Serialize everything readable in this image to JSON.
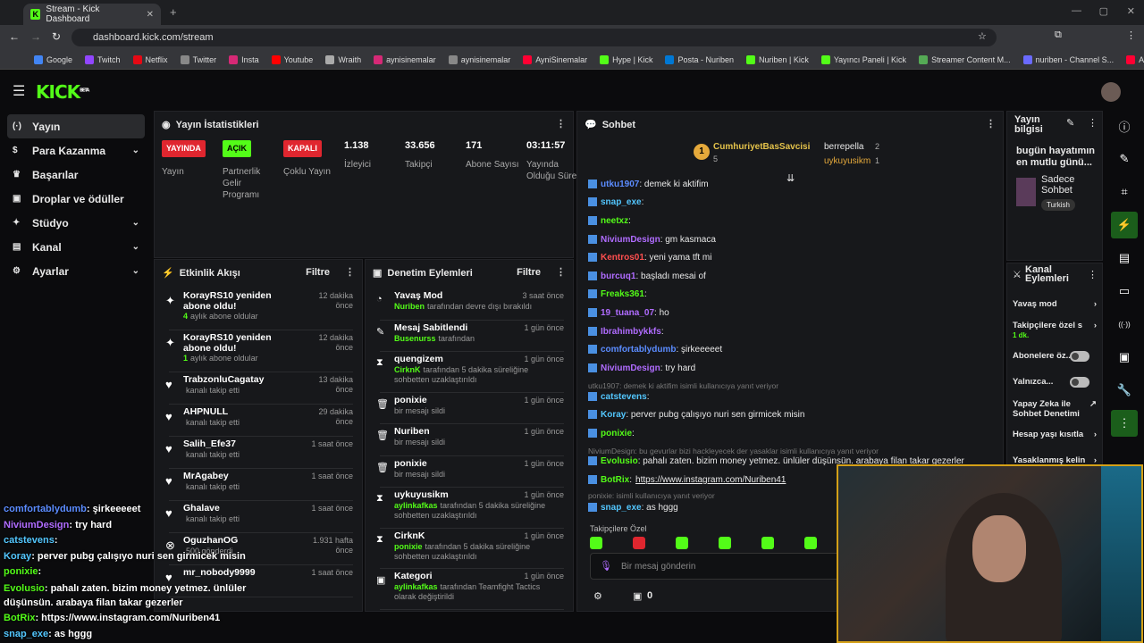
{
  "browser": {
    "tab_title": "Stream - Kick Dashboard",
    "url": "dashboard.kick.com/stream",
    "bookmarks": [
      "Google",
      "Twitch",
      "Netflix",
      "Twitter",
      "Insta",
      "Youtube",
      "Wraith",
      "aynisinemalar",
      "aynisinemalar",
      "AyniSinemalar",
      "Hype | Kick",
      "Posta - Nuriben",
      "Nuriben | Kick",
      "Yayıncı Paneli | Kick",
      "Streamer Content M...",
      "nuriben - Channel S...",
      "Aynı Sinemalar - Ça..."
    ],
    "bookmark_colors": [
      "#4285f4",
      "#9146ff",
      "#e50914",
      "#888",
      "#d62976",
      "#ff0000",
      "#aaa",
      "#d62976",
      "#888",
      "#ff0033",
      "#53fc18",
      "#0078d4",
      "#53fc18",
      "#53fc18",
      "#5a5",
      "#6a6aff",
      "#ff0033"
    ]
  },
  "brand": {
    "logo": "KICK",
    "beta": "BETA"
  },
  "sidebar": {
    "items": [
      {
        "label": "Yayın",
        "icon": "(·)"
      },
      {
        "label": "Para Kazanma",
        "icon": "$"
      },
      {
        "label": "Başarılar",
        "icon": "♛"
      },
      {
        "label": "Droplar ve ödüller",
        "icon": "▣"
      },
      {
        "label": "Stüdyo",
        "icon": "✦"
      },
      {
        "label": "Kanal",
        "icon": "▤"
      },
      {
        "label": "Ayarlar",
        "icon": "⚙"
      }
    ]
  },
  "stats": {
    "title": "Yayın İstatistikleri",
    "items": [
      {
        "badge": "YAYINDA",
        "label": "Yayın",
        "color": "#e0262f"
      },
      {
        "badge": "AÇIK",
        "label": "Partnerlik Gelir Programı",
        "color": "#53fc18"
      },
      {
        "badge": "KAPALI",
        "label": "Çoklu Yayın",
        "color": "#e0262f"
      },
      {
        "value": "1.138",
        "label": "İzleyici"
      },
      {
        "value": "33.656",
        "label": "Takipçi"
      },
      {
        "value": "171",
        "label": "Abone Sayısı"
      },
      {
        "value": "03:11:57",
        "label": "Yayında Olduğu Süre"
      }
    ]
  },
  "activity": {
    "title": "Etkinlik Akışı",
    "filter": "Filtre",
    "items": [
      {
        "icon": "✦",
        "name": "KorayRS10 yeniden abone oldu!",
        "accent": "4",
        "sub": "aylık abone oldular",
        "time": "12 dakika önce"
      },
      {
        "icon": "✦",
        "name": "KorayRS10 yeniden abone oldu!",
        "accent": "1",
        "sub": "aylık abone oldular",
        "time": "12 dakika önce"
      },
      {
        "icon": "♥",
        "name": "TrabzonluCagatay",
        "sub": "kanalı takip etti",
        "time": "13 dakika önce"
      },
      {
        "icon": "♥",
        "name": "AHPNULL",
        "sub": "kanalı takip etti",
        "time": "29 dakika önce"
      },
      {
        "icon": "♥",
        "name": "Salih_Efe37",
        "sub": "kanalı takip etti",
        "time": "1 saat önce"
      },
      {
        "icon": "♥",
        "name": "MrAgabey",
        "sub": "kanalı takip etti",
        "time": "1 saat önce"
      },
      {
        "icon": "♥",
        "name": "Ghalave",
        "sub": "kanalı takip etti",
        "time": "1 saat önce"
      },
      {
        "icon": "⊗",
        "name": "OguzhanOG",
        "sub": "500 gönderdi",
        "time": "1.931 hafta önce"
      },
      {
        "icon": "♥",
        "name": "mr_nobody9999",
        "sub": "",
        "time": "1 saat önce"
      }
    ]
  },
  "moderation": {
    "title": "Denetim Eylemleri",
    "filter": "Filtre",
    "items": [
      {
        "icon": "◔",
        "name": "Yavaş Mod",
        "user": "Nuriben",
        "sub": "tarafından devre dışı bırakıldı",
        "time": "3 saat önce"
      },
      {
        "icon": "✎",
        "name": "Mesaj Sabitlendi",
        "user": "Busenurss",
        "sub": "tarafından",
        "time": "1 gün önce"
      },
      {
        "icon": "⧗",
        "name": "quengizem",
        "user": "CirknK",
        "sub": "tarafından 5 dakika süreliğine sohbetten uzaklaştırıldı",
        "time": "1 gün önce"
      },
      {
        "icon": "🗑",
        "name": "ponixie",
        "user": "",
        "sub": "bir mesajı sildi",
        "time": "1 gün önce"
      },
      {
        "icon": "🗑",
        "name": "Nuriben",
        "user": "",
        "sub": "bir mesajı sildi",
        "time": "1 gün önce"
      },
      {
        "icon": "🗑",
        "name": "ponixie",
        "user": "",
        "sub": "bir mesajı sildi",
        "time": "1 gün önce"
      },
      {
        "icon": "⧗",
        "name": "uykuyusikm",
        "user": "aylinkafkas",
        "sub": "tarafından 5 dakika süreliğine sohbetten uzaklaştırıldı",
        "time": "1 gün önce"
      },
      {
        "icon": "⧗",
        "name": "CirknK",
        "user": "ponixie",
        "sub": "tarafından 5 dakika süreliğine sohbetten uzaklaştırıldı",
        "time": "1 gün önce"
      },
      {
        "icon": "▣",
        "name": "Kategori",
        "user": "aylinkafkas",
        "sub": "tarafından Teamfight Tactics olarak değiştirildi",
        "time": "1 gün önce"
      }
    ]
  },
  "chat": {
    "title": "Sohbet",
    "leaders": [
      {
        "rank": "1",
        "name": "CumhuriyetBasSavcisi",
        "count": "5"
      },
      {
        "name": "berrepella",
        "count": "2"
      },
      {
        "name": "uykuyusikm",
        "count": "1"
      }
    ],
    "messages": [
      {
        "user": "utku1907",
        "color": "#5b8cff",
        "text": ": demek ki aktifim"
      },
      {
        "user": "snap_exe",
        "color": "#53c7ff",
        "text": ":"
      },
      {
        "user": "neetxz",
        "color": "#53fc18",
        "text": ":"
      },
      {
        "user": "NiviumDesign",
        "color": "#b06cff",
        "text": ": gm kasmaca"
      },
      {
        "user": "Kentros01",
        "color": "#ff4f4f",
        "text": ": yeni yama tft mi"
      },
      {
        "user": "burcuq1",
        "color": "#b06cff",
        "text": ": başladı mesai of"
      },
      {
        "user": "Freaks361",
        "color": "#53fc18",
        "text": ":"
      },
      {
        "user": "19_tuana_07",
        "color": "#b06cff",
        "text": ": ho"
      },
      {
        "user": "Ibrahimbykkfs",
        "color": "#b06cff",
        "text": ":"
      },
      {
        "user": "comfortablydumb",
        "color": "#5b8cff",
        "text": ": şirkeeeeet"
      },
      {
        "user": "NiviumDesign",
        "color": "#b06cff",
        "text": ": try hard"
      },
      {
        "reply": "utku1907: demek ki aktifim isimli kullanıcıya yanıt veriyor"
      },
      {
        "user": "catstevens",
        "color": "#53c7ff",
        "text": ":"
      },
      {
        "user": "Koray",
        "color": "#53c7ff",
        "text": ": perver pubg çalışıyo nuri sen girmicek misin"
      },
      {
        "user": "ponixie",
        "color": "#53fc18",
        "text": ":"
      },
      {
        "reply": "NiviumDesign: bu gevurlar bizi hackleyecek der yasaklar isimli kullanıcıya yanıt veriyor"
      },
      {
        "user": "Evolusio",
        "color": "#53fc18",
        "text": ": pahalı zaten. bizim money yetmez. ünlüler düşünsün. arabaya filan takar gezerler"
      },
      {
        "user": "BotRix",
        "color": "#53fc18",
        "text": ":",
        "link": "https://www.instagram.com/Nuriben41"
      },
      {
        "reply": "ponixie: isimli kullanıcıya yanıt veriyor"
      },
      {
        "user": "snap_exe",
        "color": "#53c7ff",
        "text": ": as hggg"
      }
    ],
    "emote_label": "Takipçilere Özel",
    "placeholder": "Bir mesaj gönderin",
    "points": "0"
  },
  "stream_info": {
    "title": "Yayın bilgisi",
    "stream_title": "bugün hayatımın en mutlu günü...",
    "category": "Sadece Sohbet",
    "language": "Turkish"
  },
  "channel_actions": {
    "title": "Kanal Eylemleri",
    "items": [
      {
        "label": "Yavaş mod"
      },
      {
        "label": "Takipçilere özel s",
        "sub": "1 dk."
      },
      {
        "label": "Abonelere öz..."
      },
      {
        "label": "Yalnızca..."
      },
      {
        "label": "Yapay Zeka ile Sohbet Denetimi"
      },
      {
        "label": "Hesap yaşı kısıtla"
      },
      {
        "label": "Yasaklanmış kelin"
      }
    ]
  },
  "overlay": [
    {
      "user": "comfortablydumb",
      "color": "#5b8cff",
      "text": ": şirkeeeeet"
    },
    {
      "user": "NiviumDesign",
      "color": "#b06cff",
      "text": ": try hard"
    },
    {
      "user": "catstevens",
      "color": "#53c7ff",
      "text": ":"
    },
    {
      "user": "Koray",
      "color": "#53c7ff",
      "text": ": perver pubg çalışıyo nuri sen girmicek misin"
    },
    {
      "user": "ponixie",
      "color": "#53fc18",
      "text": ":"
    },
    {
      "user": "Evolusio",
      "color": "#53fc18",
      "text": ": pahalı zaten. bizim money yetmez. ünlüler"
    },
    {
      "user": "",
      "color": "#fff",
      "text": "düşünsün. arabaya filan takar gezerler"
    },
    {
      "user": "BotRix",
      "color": "#53fc18",
      "text": ": https://www.instagram.com/Nuriben41"
    },
    {
      "user": "snap_exe",
      "color": "#53c7ff",
      "text": ": as hggg"
    }
  ]
}
